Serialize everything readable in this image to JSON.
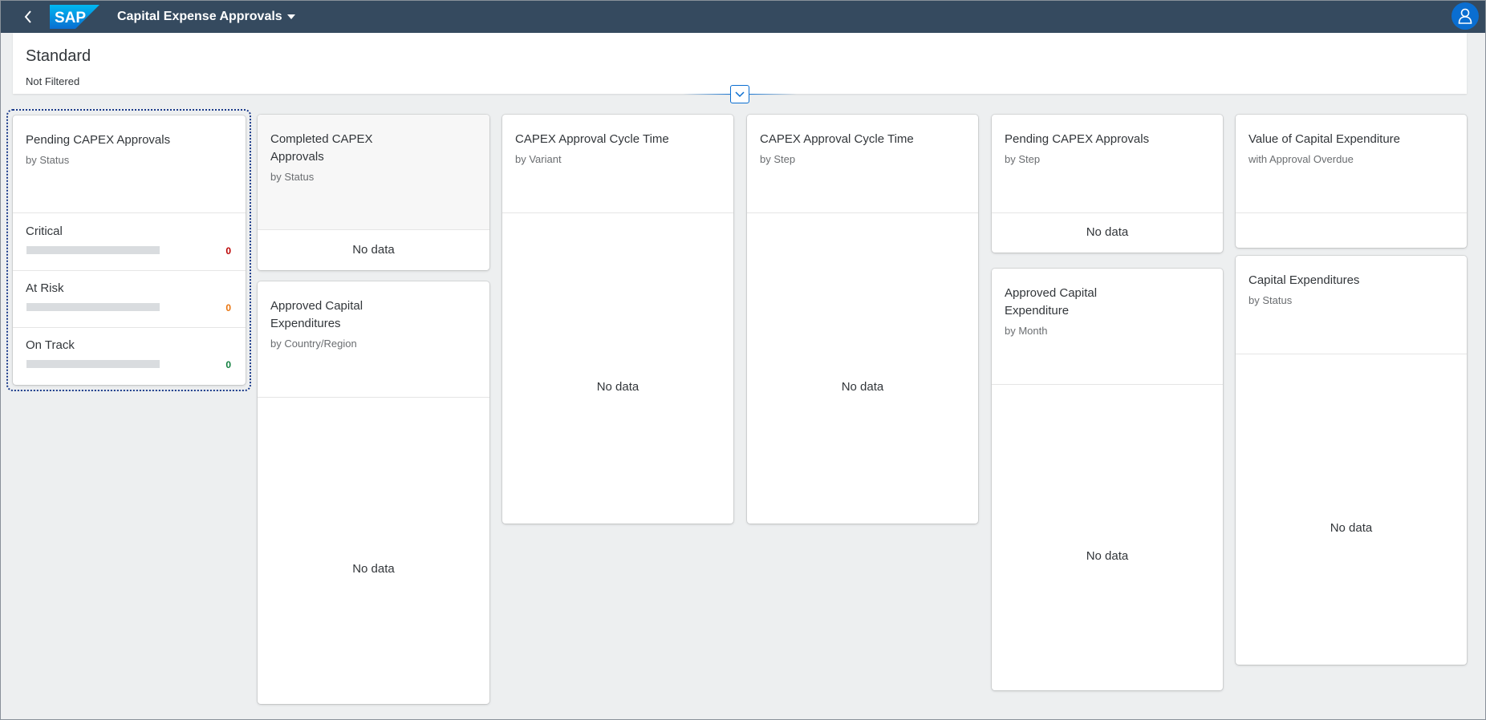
{
  "shell": {
    "logo_text": "SAP",
    "app_title": "Capital Expense Approvals"
  },
  "header": {
    "variant": "Standard",
    "filter_status": "Not Filtered"
  },
  "colors": {
    "critical": "#bb0000",
    "at_risk": "#e9730c",
    "on_track": "#107e3e",
    "brand": "#0a6ed1",
    "shell_bg": "#354a5f"
  },
  "cards": {
    "pending_status": {
      "title": "Pending CAPEX Approvals",
      "subtitle": "by Status",
      "items": [
        {
          "label": "Critical",
          "value": "0",
          "progress": 0
        },
        {
          "label": "At Risk",
          "value": "0",
          "progress": 0
        },
        {
          "label": "On Track",
          "value": "0",
          "progress": 0
        }
      ]
    },
    "completed_status": {
      "title_line1": "Completed CAPEX",
      "title_line2": "Approvals",
      "subtitle": "by Status",
      "no_data": "No data"
    },
    "approved_country": {
      "title_line1": "Approved Capital",
      "title_line2": "Expenditures",
      "subtitle": "by Country/Region",
      "no_data": "No data"
    },
    "cycle_variant": {
      "title": "CAPEX Approval Cycle Time",
      "subtitle": "by Variant",
      "no_data": "No data"
    },
    "cycle_step": {
      "title": "CAPEX Approval Cycle Time",
      "subtitle": "by Step",
      "no_data": "No data"
    },
    "pending_step": {
      "title": "Pending CAPEX Approvals",
      "subtitle": "by Step",
      "no_data": "No data"
    },
    "approved_month": {
      "title_line1": "Approved Capital",
      "title_line2": "Expenditure",
      "subtitle": "by Month",
      "no_data": "No data"
    },
    "value_overdue": {
      "title": "Value of Capital Expenditure",
      "subtitle": "with Approval Overdue"
    },
    "capex_status": {
      "title": "Capital Expenditures",
      "subtitle": "by Status",
      "no_data": "No data"
    }
  }
}
